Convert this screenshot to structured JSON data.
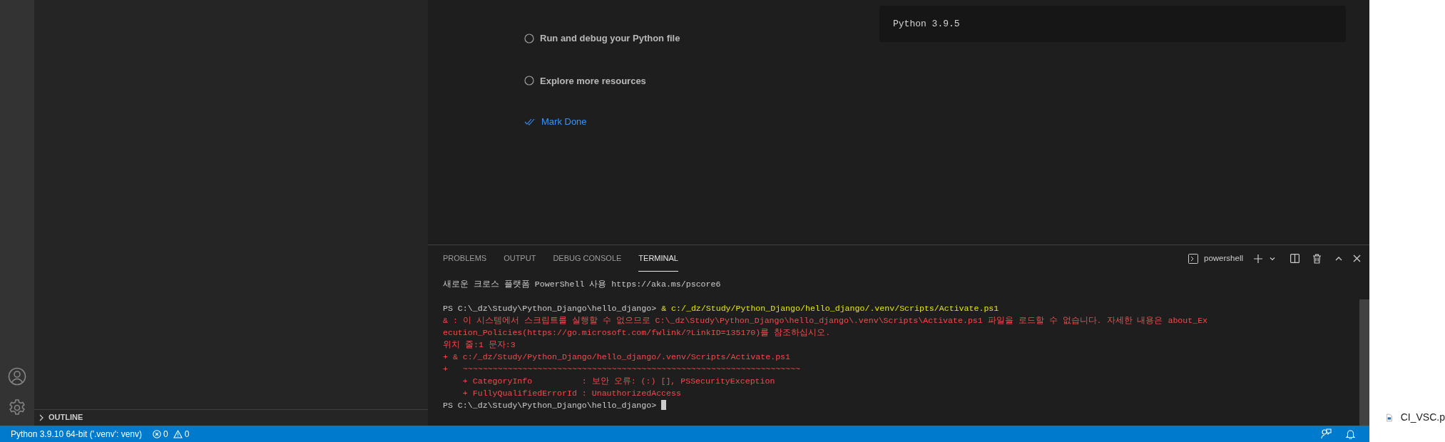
{
  "walkthrough": {
    "steps": [
      {
        "label": "Run and debug your Python file",
        "done": false
      },
      {
        "label": "Explore more resources",
        "done": false
      }
    ],
    "mark_done": "Mark Done",
    "code": "Python 3.9.5"
  },
  "sidebar": {
    "outline": {
      "label": "OUTLINE",
      "expanded": false
    }
  },
  "panel": {
    "tabs": [
      {
        "label": "PROBLEMS",
        "selected": false
      },
      {
        "label": "OUTPUT",
        "selected": false
      },
      {
        "label": "DEBUG CONSOLE",
        "selected": false
      },
      {
        "label": "TERMINAL",
        "selected": true
      }
    ],
    "terminal_name": "powershell",
    "lines": [
      {
        "kind": "plain",
        "text": "새로운 크로스 플랫폼 PowerShell 사용 https://aka.ms/pscore6"
      },
      {
        "kind": "blank"
      },
      {
        "kind": "prompt",
        "prompt": "PS C:\\_dz\\Study\\Python_Django\\hello_django>",
        "command": "& c:/_dz/Study/Python_Django/hello_django/.venv/Scripts/Activate.ps1"
      },
      {
        "kind": "error",
        "text": "& : 이 시스템에서 스크립트를 실행할 수 없으므로 C:\\_dz\\Study\\Python_Django\\hello_django\\.venv\\Scripts\\Activate.ps1 파일을 로드할 수 없습니다. 자세한 내용은 about_Ex"
      },
      {
        "kind": "error",
        "text": "ecution_Policies(https://go.microsoft.com/fwlink/?LinkID=135170)를 참조하십시오."
      },
      {
        "kind": "error",
        "text": "위치 줄:1 문자:3"
      },
      {
        "kind": "error",
        "text": "+ & c:/_dz/Study/Python_Django/hello_django/.venv/Scripts/Activate.ps1"
      },
      {
        "kind": "error",
        "text": "+   ~~~~~~~~~~~~~~~~~~~~~~~~~~~~~~~~~~~~~~~~~~~~~~~~~~~~~~~~~~~~~~~~~~~~"
      },
      {
        "kind": "error",
        "text": "    + CategoryInfo          : 보안 오류: (:) [], PSSecurityException"
      },
      {
        "kind": "error",
        "text": "    + FullyQualifiedErrorId : UnauthorizedAccess"
      },
      {
        "kind": "prompt",
        "prompt": "PS C:\\_dz\\Study\\Python_Django\\hello_django>",
        "cursor": true
      }
    ]
  },
  "status_bar": {
    "interpreter": "Python 3.9.10 64-bit ('.venv': venv)",
    "errors": "0",
    "warnings": "0"
  },
  "desktop": {
    "file": "CI_VSC.p"
  }
}
